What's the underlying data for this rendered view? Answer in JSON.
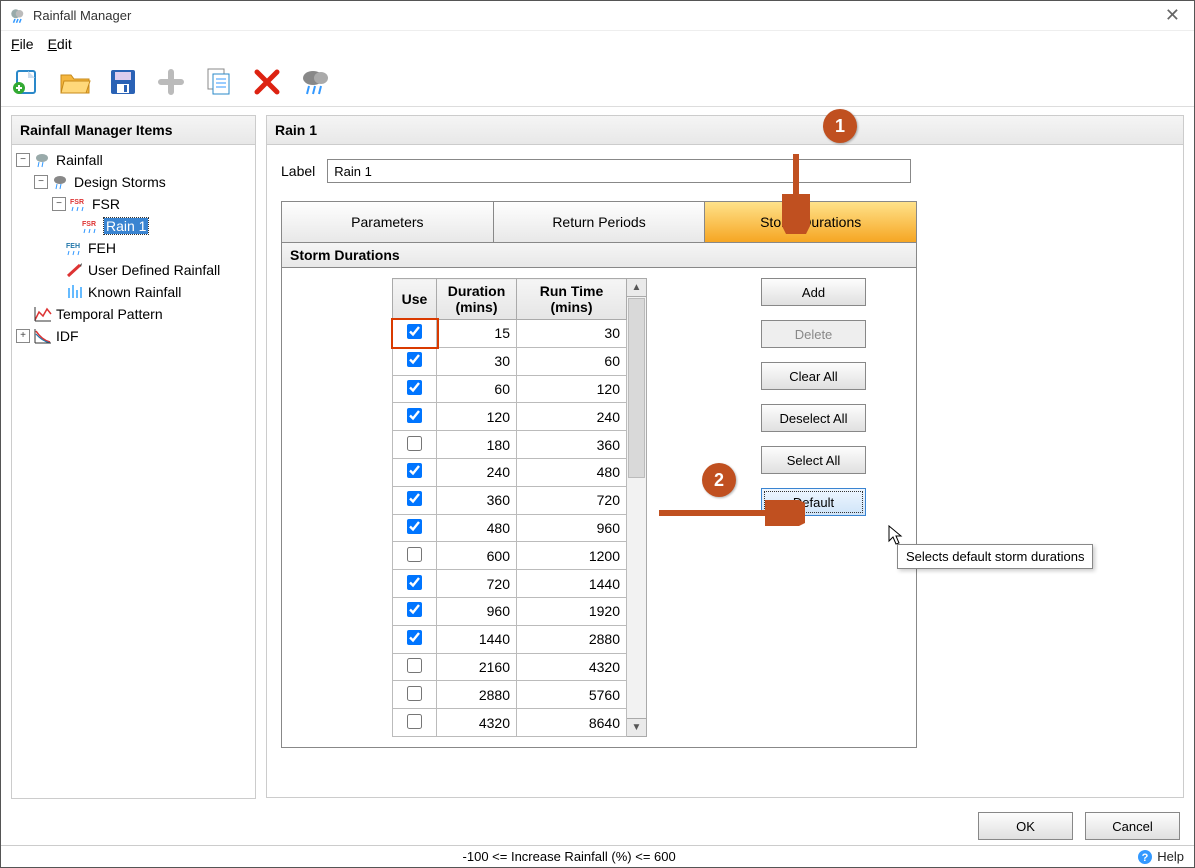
{
  "window": {
    "title": "Rainfall Manager"
  },
  "menu": {
    "file": "File",
    "edit": "Edit"
  },
  "sidebar": {
    "header": "Rainfall Manager Items",
    "items": {
      "rainfall": "Rainfall",
      "design_storms": "Design Storms",
      "fsr": "FSR",
      "rain1": "Rain 1",
      "feh": "FEH",
      "user_defined": "User Defined Rainfall",
      "known": "Known Rainfall",
      "temporal": "Temporal Pattern",
      "idf": "IDF"
    }
  },
  "main": {
    "header": "Rain 1",
    "label_text": "Label",
    "label_value": "Rain 1",
    "tabs": {
      "parameters": "Parameters",
      "return_periods": "Return Periods",
      "storm_durations": "Storm Durations"
    },
    "section_title": "Storm Durations",
    "table": {
      "headers": {
        "use": "Use",
        "duration": "Duration (mins)",
        "runtime": "Run Time (mins)"
      },
      "rows": [
        {
          "use": true,
          "duration": 15,
          "runtime": 30
        },
        {
          "use": true,
          "duration": 30,
          "runtime": 60
        },
        {
          "use": true,
          "duration": 60,
          "runtime": 120
        },
        {
          "use": true,
          "duration": 120,
          "runtime": 240
        },
        {
          "use": false,
          "duration": 180,
          "runtime": 360
        },
        {
          "use": true,
          "duration": 240,
          "runtime": 480
        },
        {
          "use": true,
          "duration": 360,
          "runtime": 720
        },
        {
          "use": true,
          "duration": 480,
          "runtime": 960
        },
        {
          "use": false,
          "duration": 600,
          "runtime": 1200
        },
        {
          "use": true,
          "duration": 720,
          "runtime": 1440
        },
        {
          "use": true,
          "duration": 960,
          "runtime": 1920
        },
        {
          "use": true,
          "duration": 1440,
          "runtime": 2880
        },
        {
          "use": false,
          "duration": 2160,
          "runtime": 4320
        },
        {
          "use": false,
          "duration": 2880,
          "runtime": 5760
        },
        {
          "use": false,
          "duration": 4320,
          "runtime": 8640
        }
      ]
    },
    "buttons": {
      "add": "Add",
      "delete": "Delete",
      "clear_all": "Clear All",
      "deselect_all": "Deselect All",
      "select_all": "Select All",
      "default": "Default"
    },
    "tooltip": "Selects default storm durations"
  },
  "dialog": {
    "ok": "OK",
    "cancel": "Cancel",
    "help": "Help"
  },
  "status": {
    "message": "-100 <= Increase Rainfall (%) <= 600"
  },
  "annotations": {
    "c1": "1",
    "c2": "2"
  }
}
